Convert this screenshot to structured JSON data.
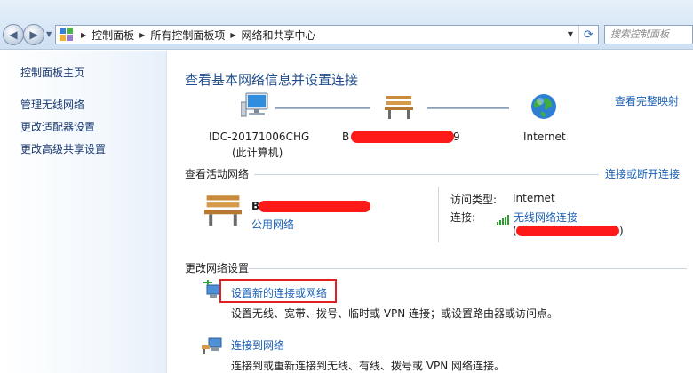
{
  "toolbar": {
    "breadcrumbs": [
      "控制面板",
      "所有控制面板项",
      "网络和共享中心"
    ],
    "search_placeholder": "搜索控制面板"
  },
  "sidebar": {
    "items": [
      {
        "label": "控制面板主页"
      },
      {
        "label": "管理无线网络"
      },
      {
        "label": "更改适配器设置"
      },
      {
        "label": "更改高级共享设置"
      }
    ]
  },
  "main": {
    "title": "查看基本网络信息并设置连接",
    "full_map_link": "查看完整映射",
    "map": {
      "computer_name": "IDC-20171006CHG",
      "computer_note": "(此计算机)",
      "network_prefix": "B",
      "network_suffix": "9",
      "internet_label": "Internet"
    },
    "active_networks": {
      "header": "查看活动网络",
      "connect_disconnect_link": "连接或断开连接",
      "network_prefix": "B",
      "network_type": "公用网络",
      "access_type_label": "访问类型:",
      "access_type_value": "Internet",
      "connection_label": "连接:",
      "connection_value": "无线网络连接",
      "ssid_open": "(",
      "ssid_close": ")"
    },
    "change_settings": {
      "header": "更改网络设置",
      "tasks": [
        {
          "title": "设置新的连接或网络",
          "description": "设置无线、宽带、拨号、临时或 VPN 连接；或设置路由器或访问点。"
        },
        {
          "title": "连接到网络",
          "description": "连接到或重新连接到无线、有线、拨号或 VPN 网络连接。"
        }
      ]
    }
  },
  "colors": {
    "link": "#1a5fb4",
    "title": "#1f4c8a",
    "redaction": "#ff1a1a",
    "highlight": "#e02020"
  }
}
